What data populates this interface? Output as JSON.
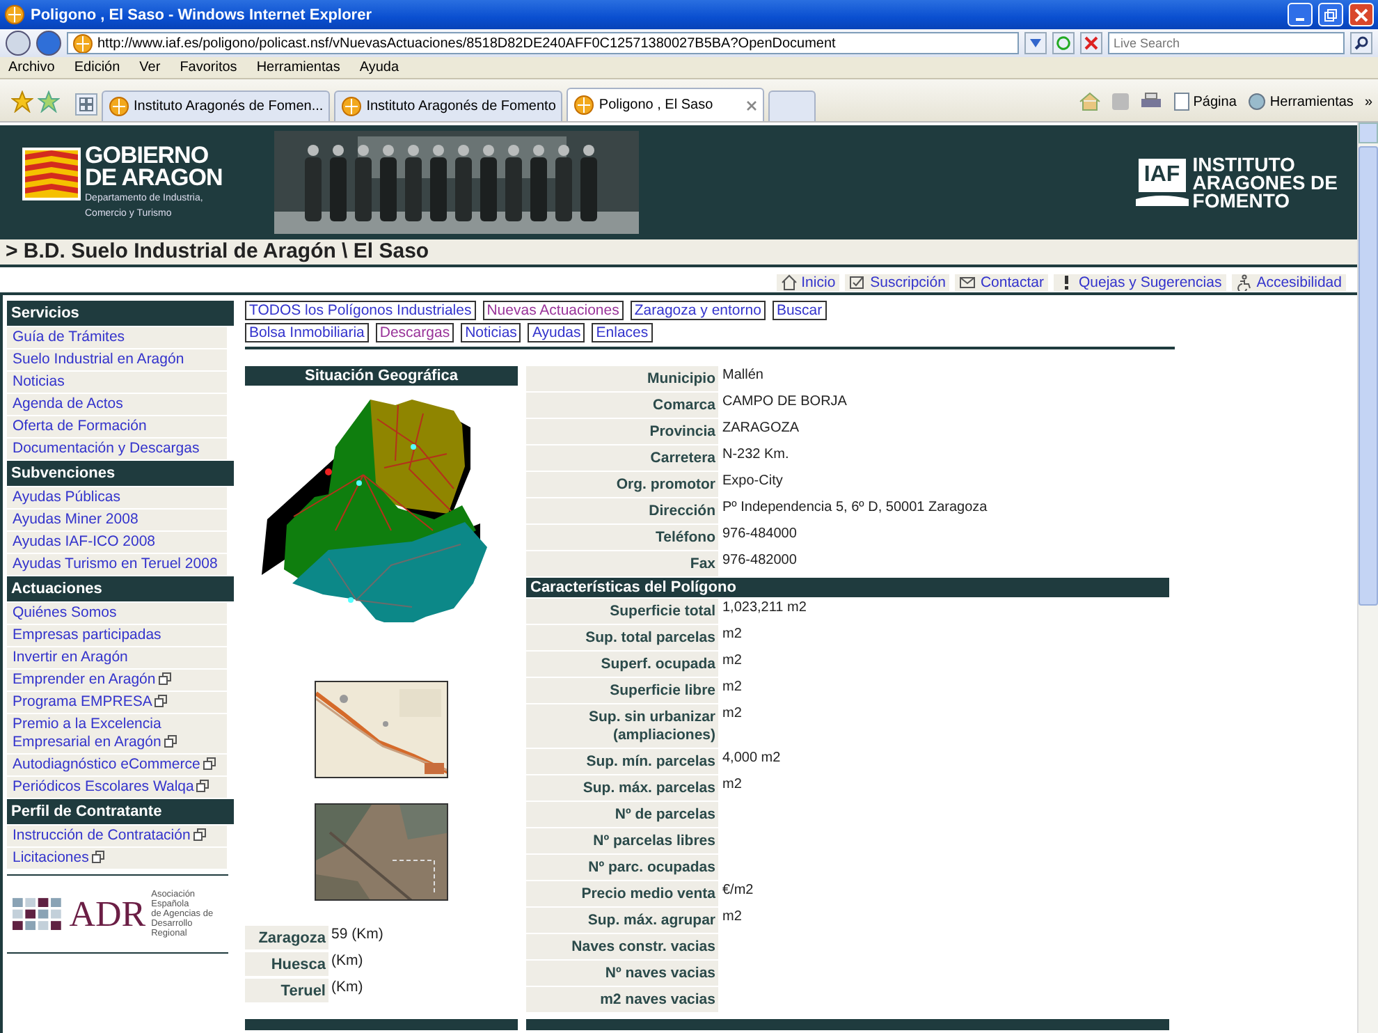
{
  "window": {
    "title": "Poligono , El Saso - Windows Internet Explorer"
  },
  "address_bar": {
    "url": "http://www.iaf.es/poligono/policast.nsf/vNuevasActuaciones/8518D82DE240AFF0C12571380027B5BA?OpenDocument",
    "search_placeholder": "Live Search"
  },
  "menu": [
    "Archivo",
    "Edición",
    "Ver",
    "Favoritos",
    "Herramientas",
    "Ayuda"
  ],
  "tabs": [
    {
      "label": "Instituto Aragonés de Fomen...",
      "selected": false
    },
    {
      "label": "Instituto Aragonés de Fomento",
      "selected": false
    },
    {
      "label": "Poligono , El Saso",
      "selected": true
    }
  ],
  "toolbar": [
    "Página",
    "Herramientas",
    "»"
  ],
  "banner": {
    "gov_logo": [
      "GOBIERNO",
      "DE ARAGON"
    ],
    "gov_dept": [
      "Departamento de Industria,",
      "Comercio y Turismo"
    ],
    "iaf_mark": "IAF",
    "iaf_name": [
      "INSTITUTO",
      "ARAGONES DE",
      "FOMENTO"
    ]
  },
  "breadcrumb": "> B.D. Suelo Industrial de Aragón \\ El Saso",
  "top_links": [
    {
      "label": "Inicio",
      "kind": "home"
    },
    {
      "label": "Suscripción",
      "kind": "subscribe"
    },
    {
      "label": "Contactar",
      "kind": "mail"
    },
    {
      "label": "Quejas y Sugerencias",
      "kind": "alert"
    },
    {
      "label": "Accesibilidad",
      "kind": "access"
    }
  ],
  "sidebar": [
    {
      "title": "Servicios",
      "items": [
        {
          "label": "Guía de Trámites",
          "external": false
        },
        {
          "label": "Suelo Industrial en Aragón",
          "external": false
        },
        {
          "label": "Noticias",
          "external": false
        },
        {
          "label": "Agenda de Actos",
          "external": false
        },
        {
          "label": "Oferta de Formación",
          "external": false
        },
        {
          "label": "Documentación y Descargas",
          "external": false
        }
      ]
    },
    {
      "title": "Subvenciones",
      "items": [
        {
          "label": "Ayudas Públicas",
          "external": false
        },
        {
          "label": "Ayudas Miner 2008",
          "external": false
        },
        {
          "label": "Ayudas IAF-ICO 2008",
          "external": false
        },
        {
          "label": "Ayudas Turismo en Teruel 2008",
          "external": false
        }
      ]
    },
    {
      "title": "Actuaciones",
      "items": [
        {
          "label": "Quiénes Somos",
          "external": false
        },
        {
          "label": "Empresas participadas",
          "external": false
        },
        {
          "label": "Invertir en Aragón",
          "external": false
        },
        {
          "label": "Emprender en Aragón",
          "external": true
        },
        {
          "label": "Programa EMPRESA",
          "external": true
        },
        {
          "label": "Premio a la Excelencia Empresarial en Aragón",
          "external": true
        },
        {
          "label": "Autodiagnóstico eCommerce",
          "external": true
        },
        {
          "label": "Periódicos Escolares Walqa",
          "external": true
        }
      ]
    },
    {
      "title": "Perfil de Contratante",
      "items": [
        {
          "label": "Instrucción de Contratación",
          "external": true
        },
        {
          "label": "Licitaciones",
          "external": true
        }
      ]
    }
  ],
  "adr_logo": {
    "mark": "ADR",
    "name": [
      "Asociación Española",
      "de Agencias de",
      "Desarrollo Regional"
    ]
  },
  "nav_links": [
    [
      {
        "label": "TODOS los Polígonos Industriales",
        "visited": false
      },
      {
        "label": "Nuevas Actuaciones",
        "visited": true
      },
      {
        "label": "Zaragoza y entorno",
        "visited": false
      },
      {
        "label": "Buscar",
        "visited": false
      }
    ],
    [
      {
        "label": "Bolsa Inmobiliaria",
        "visited": false
      },
      {
        "label": "Descargas",
        "visited": true
      },
      {
        "label": "Noticias",
        "visited": false
      },
      {
        "label": "Ayudas",
        "visited": false
      },
      {
        "label": "Enlaces",
        "visited": false
      }
    ]
  ],
  "location": {
    "title": "Situación Geográfica",
    "distances": [
      {
        "city": "Zaragoza",
        "value": "59 (Km)"
      },
      {
        "city": "Huesca",
        "value": "(Km)"
      },
      {
        "city": "Teruel",
        "value": "(Km)"
      }
    ]
  },
  "details": [
    {
      "label": "Municipio",
      "value": "Mallén"
    },
    {
      "label": "Comarca",
      "value": "CAMPO DE BORJA"
    },
    {
      "label": "Provincia",
      "value": "ZARAGOZA"
    },
    {
      "label": "Carretera",
      "value": "N-232 Km."
    },
    {
      "label": "Org. promotor",
      "value": "Expo-City"
    },
    {
      "label": "Dirección",
      "value": "Pº Independencia 5, 6º D, 50001 Zaragoza"
    },
    {
      "label": "Teléfono",
      "value": "976-484000"
    },
    {
      "label": "Fax",
      "value": "976-482000"
    }
  ],
  "characteristics": {
    "title": "Características del Polígono",
    "rows": [
      {
        "label": "Superficie total",
        "value": "1,023,211 m2"
      },
      {
        "label": "Sup. total parcelas",
        "value": "m2"
      },
      {
        "label": "Superf. ocupada",
        "value": "m2"
      },
      {
        "label": "Superficie libre",
        "value": "m2"
      },
      {
        "label": "Sup. sin urbanizar (ampliaciones)",
        "value": "m2"
      },
      {
        "label": "Sup. mín. parcelas",
        "value": "4,000 m2"
      },
      {
        "label": "Sup. máx. parcelas",
        "value": "m2"
      },
      {
        "label": "Nº de parcelas"
      },
      {
        "label": "Nº parcelas libres"
      },
      {
        "label": "Nº parc. ocupadas"
      },
      {
        "label": "Precio medio venta",
        "value": "€/m2"
      },
      {
        "label": "Sup. máx. agrupar",
        "value": "m2"
      },
      {
        "label": "Naves constr. vacias"
      },
      {
        "label": "Nº naves vacias"
      },
      {
        "label": "m2 naves vacias"
      }
    ]
  }
}
